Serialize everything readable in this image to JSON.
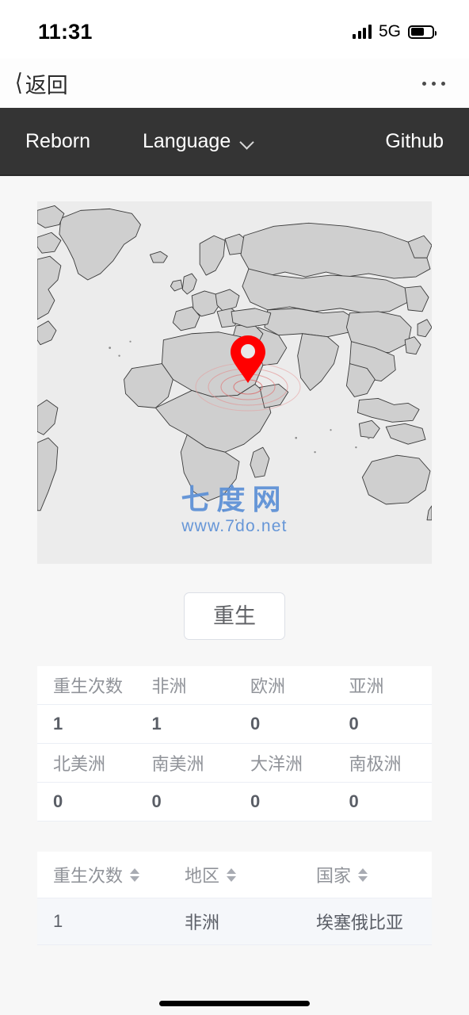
{
  "status_bar": {
    "time": "11:31",
    "network": "5G",
    "battery_percent": 62
  },
  "nav_bar": {
    "back_label": "返回",
    "back_icon": "chevron-left-icon",
    "more_icon": "more-dots-icon"
  },
  "site_header": {
    "brand": "Reborn",
    "language_label": "Language",
    "language_icon": "chevron-down-icon",
    "github_label": "Github"
  },
  "map": {
    "marker_icon": "map-pin-icon",
    "marker_color": "#ff0000",
    "land_color": "#cfcfcf",
    "border_color": "#3a3a3a",
    "ocean_color": "#ececec",
    "watermark_cn": "七度网",
    "watermark_url": "www.7do.net",
    "watermark_color": "#5b8fd6"
  },
  "reborn_button": {
    "label": "重生"
  },
  "stats_table": {
    "rows": [
      {
        "headers": [
          "重生次数",
          "非洲",
          "欧洲",
          "亚洲"
        ],
        "values": [
          "1",
          "1",
          "0",
          "0"
        ]
      },
      {
        "headers": [
          "北美洲",
          "南美洲",
          "大洋洲",
          "南极洲"
        ],
        "values": [
          "0",
          "0",
          "0",
          "0"
        ]
      }
    ]
  },
  "history_table": {
    "columns": [
      {
        "label": "重生次数",
        "sortable": true,
        "sort_icon": "sort-caret-icon"
      },
      {
        "label": "地区",
        "sortable": true,
        "sort_icon": "sort-caret-icon"
      },
      {
        "label": "国家",
        "sortable": true,
        "sort_icon": "sort-caret-icon"
      }
    ],
    "rows": [
      {
        "count": "1",
        "region": "非洲",
        "country": "埃塞俄比亚"
      }
    ]
  }
}
